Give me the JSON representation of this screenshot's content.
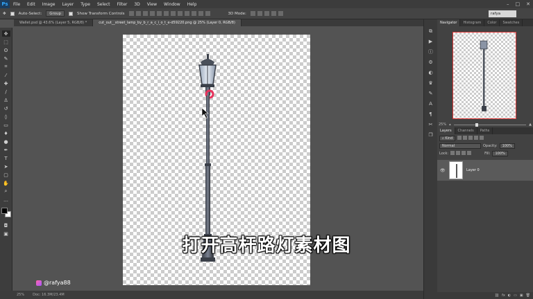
{
  "app": {
    "logo": "Ps"
  },
  "menu": [
    "File",
    "Edit",
    "Image",
    "Layer",
    "Type",
    "Select",
    "Filter",
    "3D",
    "View",
    "Window",
    "Help"
  ],
  "window_controls": [
    "–",
    "□",
    "✕"
  ],
  "options_bar": {
    "auto_select_label": "Auto-Select:",
    "group_value": "Group",
    "transform_label": "Show Transform Controls",
    "mode_3d": "3D Mode:",
    "workspace_value": "rafya"
  },
  "tabs": [
    {
      "label": "Wallet.psd @ 43.6% (Layer 5, RGB/8) *",
      "active": false
    },
    {
      "label": "cut_out__street_lamp_by_b_r_a_c_i_o_t_e-d59220.png @ 25% (Layer 0, RGB/8)",
      "active": true
    }
  ],
  "statusbar": {
    "zoom": "25%",
    "doc": "Doc: 16.3M/23.4M"
  },
  "panels": {
    "nav_tabs": [
      "Navigator",
      "Histogram",
      "Color",
      "Swatches"
    ],
    "nav_zoom": "25%",
    "layer_tabs": [
      "Layers",
      "Channels",
      "Paths"
    ],
    "kind_label": "Kind",
    "blend_mode": "Normal",
    "opacity_label": "Opacity:",
    "opacity_value": "100%",
    "lock_label": "Lock:",
    "fill_label": "Fill:",
    "fill_value": "100%",
    "layer_name": "Layer 0",
    "footer_icons": [
      "fx",
      "◐",
      "▭",
      "▣",
      "🗑"
    ]
  },
  "subtitle": "打开高杆路灯素材图",
  "watermark": "@rafya88",
  "colors": {
    "accent_red": "#e03a3a",
    "highlight_pink": "#e8335c"
  }
}
